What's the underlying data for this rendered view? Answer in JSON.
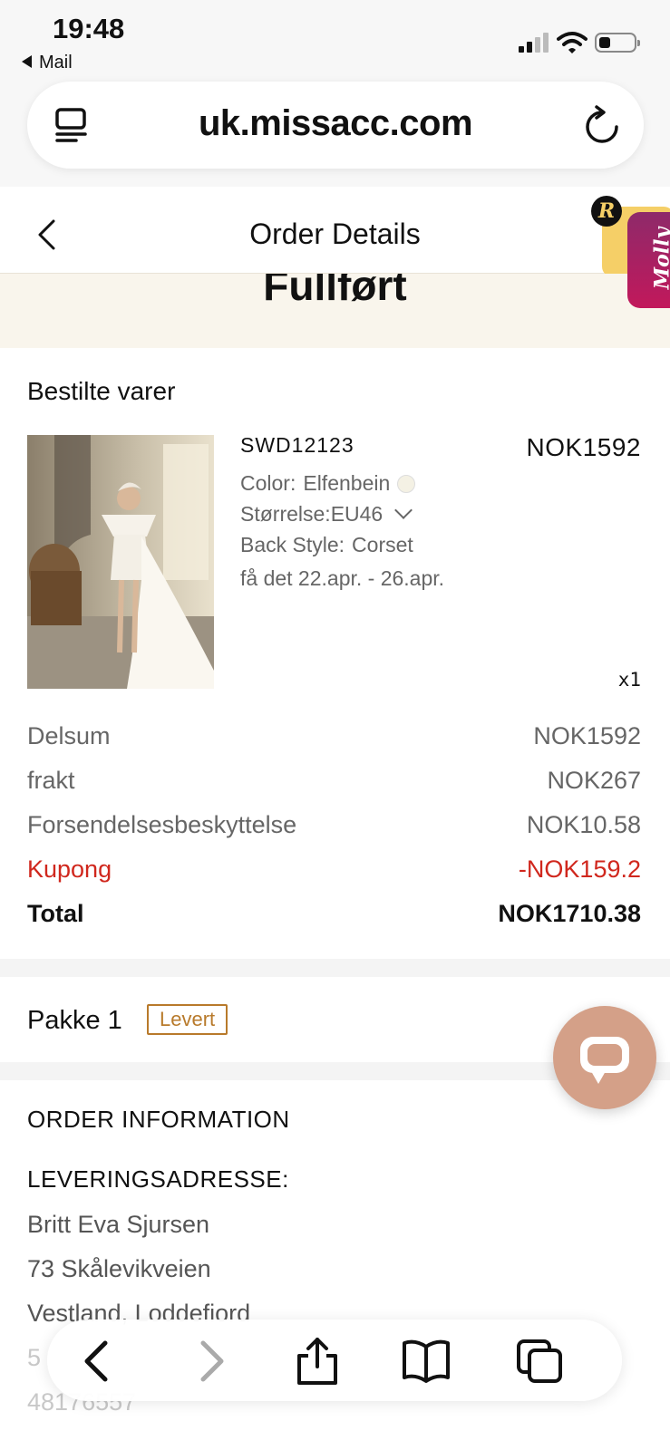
{
  "status_bar": {
    "time": "19:48",
    "back_app": "Mail"
  },
  "browser": {
    "url": "uk.missacc.com"
  },
  "header": {
    "title": "Order Details"
  },
  "promo": {
    "badge_letter": "R",
    "molly_label": "Molly"
  },
  "order_status": "Fullført",
  "items_section": {
    "title": "Bestilte varer",
    "item": {
      "sku": "SWD12123",
      "price": "NOK1592",
      "color_label": "Color:",
      "color_value": "Elfenbein",
      "size_label": "Størrelse:",
      "size_value": "EU46",
      "back_label": "Back Style:",
      "back_value": "Corset",
      "delivery": "få det 22.apr. - 26.apr.",
      "quantity": "x1"
    }
  },
  "summary": {
    "subtotal_label": "Delsum",
    "subtotal_value": "NOK1592",
    "shipping_label": "frakt",
    "shipping_value": "NOK267",
    "protection_label": "Forsendelsesbeskyttelse",
    "protection_value": "NOK10.58",
    "coupon_label": "Kupong",
    "coupon_value": "-NOK159.2",
    "total_label": "Total",
    "total_value": "NOK1710.38"
  },
  "package": {
    "label": "Pakke 1",
    "status": "Levert"
  },
  "order_info": {
    "title": "ORDER INFORMATION",
    "address_label": "LEVERINGSADRESSE:",
    "name": "Britt Eva Sjursen",
    "street": "73 Skålevikveien",
    "region": "Vestland, Loddefiord",
    "postal_partial": "5",
    "phone_partial": "48176557"
  },
  "colors": {
    "coupon_red": "#d0271d",
    "badge_brown": "#b87a2b",
    "chat_bubble": "#d4a088",
    "status_band": "#f9f5ec"
  }
}
